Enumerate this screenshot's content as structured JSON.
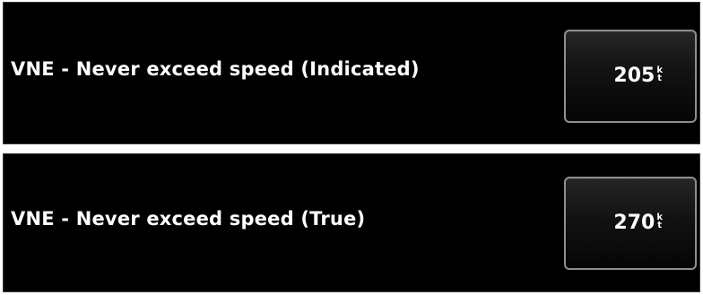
{
  "settings": [
    {
      "label": "VNE - Never exceed speed (Indicated)",
      "value": "205",
      "unit_top": "k",
      "unit_bottom": "t"
    },
    {
      "label": "VNE - Never exceed speed (True)",
      "value": "270",
      "unit_top": "k",
      "unit_bottom": "t"
    }
  ],
  "colors": {
    "panel_background": "#000000",
    "text": "#ffffff",
    "button_border": "#8e8e8e",
    "page_background": "#ffffff"
  }
}
